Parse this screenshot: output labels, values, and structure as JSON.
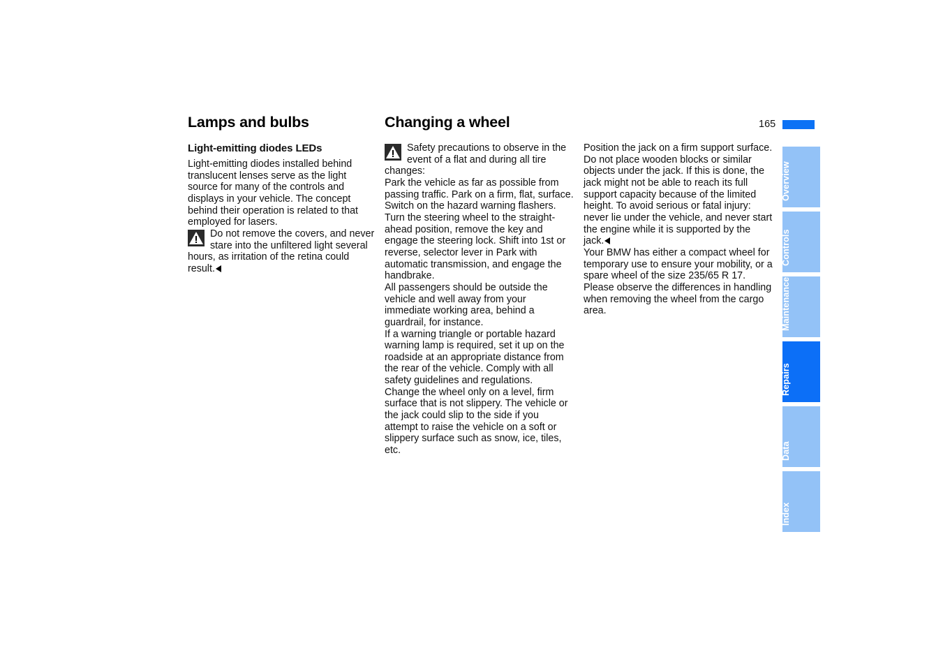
{
  "page": {
    "number": "165",
    "accent_color": "#0c72f5",
    "tab_inactive_color": "#93c2f7",
    "tab_active_color": "#0c6ff7"
  },
  "columns": {
    "col1": {
      "heading": "Lamps and bulbs",
      "subheading": "Light-emitting diodes LEDs",
      "paragraph": "Light-emitting diodes installed behind translucent lenses serve as the light source for many of the controls and displays in your vehicle. The concept behind their operation is related to that employed for lasers.",
      "warning": "Do not remove the covers, and never stare into the unfiltered light several hours, as irritation of the retina could result."
    },
    "col2": {
      "heading": "Changing a wheel",
      "warning_intro": "Safety precautions to observe in the event of a flat and during all tire changes:",
      "paragraphs": [
        "Park the vehicle as far as possible from passing traffic. Park on a firm, flat, surface. Switch on the hazard warning flashers.",
        "Turn the steering wheel to the straight-ahead position, remove the key and engage the steering lock. Shift into 1st or reverse, selector lever in Park with automatic transmission, and engage the handbrake.",
        "All passengers should be outside the vehicle and well away from your immediate working area, behind a guardrail, for instance.",
        "If a warning triangle or portable hazard warning lamp is required, set it up on the roadside at an appropriate distance from the rear of the vehicle. Comply with all safety guidelines and regulations.",
        "Change the wheel only on a level, firm surface that is not slippery. The vehicle or the jack could slip to the side if you attempt to raise the vehicle on a soft or slippery surface such as snow, ice, tiles, etc."
      ]
    },
    "col3": {
      "paragraphs": [
        "Position the jack on a firm support surface.",
        "Do not place wooden blocks or similar objects under the jack. If this is done, the jack might not be able to reach its full support capacity because of the limited height. To avoid serious or fatal injury: never lie under the vehicle, and never start the engine while it is supported by the jack."
      ],
      "closing_paragraph": "Your BMW has either a compact wheel for temporary use to ensure your mobility, or a spare wheel of the size 235/65 R 17. Please observe the differences in handling when removing the wheel from the cargo area."
    }
  },
  "tabs": [
    {
      "label": "Overview",
      "active": false
    },
    {
      "label": "Controls",
      "active": false
    },
    {
      "label": "Maintenance",
      "active": false
    },
    {
      "label": "Repairs",
      "active": true
    },
    {
      "label": "Data",
      "active": false
    },
    {
      "label": "Index",
      "active": false
    }
  ]
}
